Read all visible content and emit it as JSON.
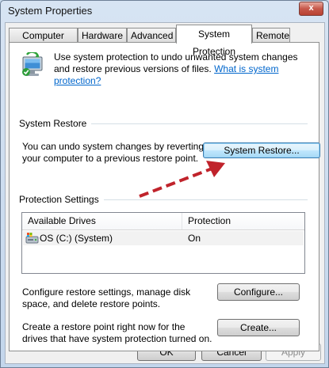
{
  "window": {
    "title": "System Properties",
    "close_glyph": "x"
  },
  "tabs": [
    {
      "label": "Computer Name"
    },
    {
      "label": "Hardware"
    },
    {
      "label": "Advanced"
    },
    {
      "label": "System Protection"
    },
    {
      "label": "Remote"
    }
  ],
  "intro": {
    "icon": "system-protection-icon",
    "text": "Use system protection to undo unwanted system changes and restore previous versions of files.",
    "link": "What is system protection?"
  },
  "system_restore": {
    "group_label": "System Restore",
    "description": "You can undo system changes by reverting your computer to a previous restore point.",
    "button": "System Restore..."
  },
  "protection_settings": {
    "group_label": "Protection Settings",
    "columns": [
      "Available Drives",
      "Protection"
    ],
    "rows": [
      {
        "drive": "OS (C:) (System)",
        "protection": "On",
        "icon": "drive-icon"
      }
    ],
    "configure_text": "Configure restore settings, manage disk space, and delete restore points.",
    "configure_button": "Configure...",
    "create_text": "Create a restore point right now for the drives that have system protection turned on.",
    "create_button": "Create..."
  },
  "annotation": {
    "arrow_color": "#c0232b"
  },
  "footer": {
    "ok": "OK",
    "cancel": "Cancel",
    "apply": "Apply"
  }
}
